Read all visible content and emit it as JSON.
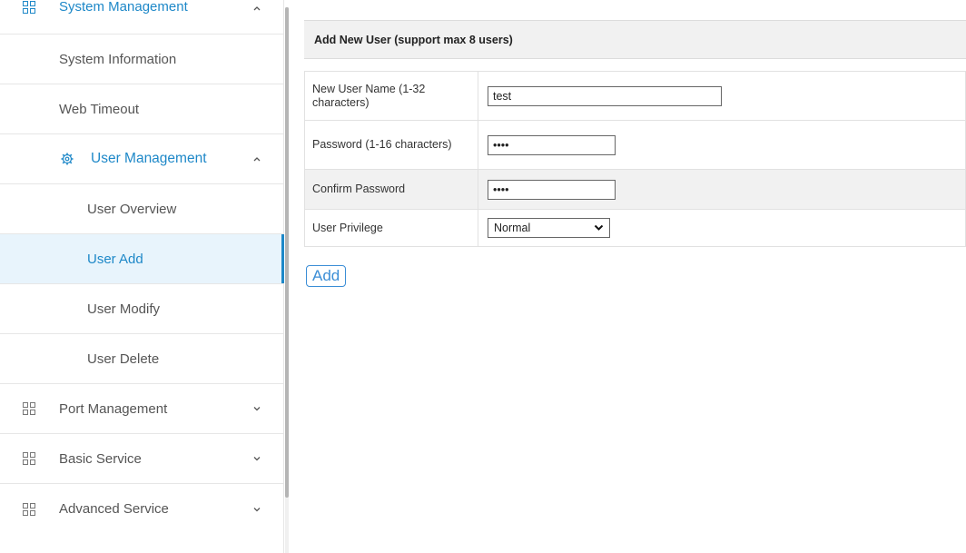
{
  "sidebar": {
    "items": [
      {
        "label": "System Management",
        "icon": "grid-icon",
        "chevron": "up"
      },
      {
        "label": "System Information"
      },
      {
        "label": "Web Timeout"
      },
      {
        "label": "User Management",
        "icon": "gear-icon",
        "chevron": "up"
      },
      {
        "label": "User Overview"
      },
      {
        "label": "User Add",
        "active": true
      },
      {
        "label": "User Modify"
      },
      {
        "label": "User Delete"
      },
      {
        "label": "Port Management",
        "icon": "grid-icon",
        "chevron": "down"
      },
      {
        "label": "Basic Service",
        "icon": "grid-icon",
        "chevron": "down"
      },
      {
        "label": "Advanced Service",
        "icon": "grid-icon",
        "chevron": "down"
      }
    ]
  },
  "main": {
    "title": "Add New User (support max 8 users)",
    "fields": {
      "username": {
        "label": "New User Name (1-32 characters)",
        "value": "test"
      },
      "password": {
        "label": "Password (1-16 characters)",
        "value": "test"
      },
      "confirm": {
        "label": "Confirm Password",
        "value": "test"
      },
      "privilege": {
        "label": "User Privilege",
        "selected": "Normal"
      }
    },
    "add_label": "Add"
  },
  "colors": {
    "accent": "#1e88c8",
    "active_bg": "#e8f4fc",
    "header_bg": "#f1f1f1"
  }
}
